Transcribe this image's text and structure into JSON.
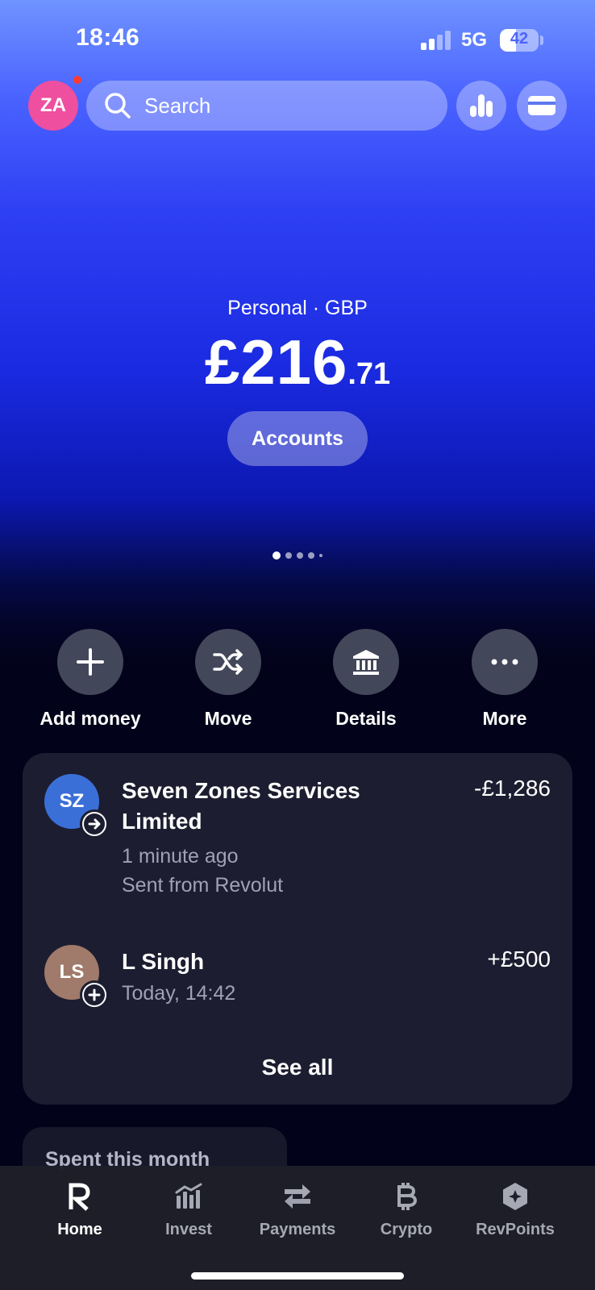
{
  "status_bar": {
    "time": "18:46",
    "network": "5G",
    "battery": "42",
    "battery_level": 0.42
  },
  "header": {
    "avatar_initials": "ZA",
    "search_placeholder": "Search"
  },
  "account": {
    "label": "Personal · GBP",
    "balance_main": "£216",
    "balance_decimal": ".71",
    "accounts_button": "Accounts"
  },
  "actions": [
    {
      "label": "Add money",
      "icon": "plus-icon"
    },
    {
      "label": "Move",
      "icon": "shuffle-icon"
    },
    {
      "label": "Details",
      "icon": "bank-icon"
    },
    {
      "label": "More",
      "icon": "more-icon"
    }
  ],
  "transactions": [
    {
      "initials": "SZ",
      "name_line1": "Seven Zones Services",
      "name_line2": "Limited",
      "time": "1 minute ago",
      "note": "Sent from Revolut",
      "amount": "-£1,286",
      "avatar_color": "#3b6fd8",
      "badge_icon": "arrow-right-icon"
    },
    {
      "initials": "LS",
      "name_line1": "L Singh",
      "time": "Today, 14:42",
      "amount": "+£500",
      "avatar_color": "#a07a6a",
      "badge_icon": "plus-icon"
    }
  ],
  "see_all": "See all",
  "spent_card": {
    "label": "Spent this month"
  },
  "nav": [
    {
      "label": "Home",
      "icon": "revolut-r-icon",
      "active": true
    },
    {
      "label": "Invest",
      "icon": "invest-chart-icon"
    },
    {
      "label": "Payments",
      "icon": "transfer-arrows-icon"
    },
    {
      "label": "Crypto",
      "icon": "bitcoin-icon"
    },
    {
      "label": "RevPoints",
      "icon": "revpoints-icon"
    }
  ]
}
